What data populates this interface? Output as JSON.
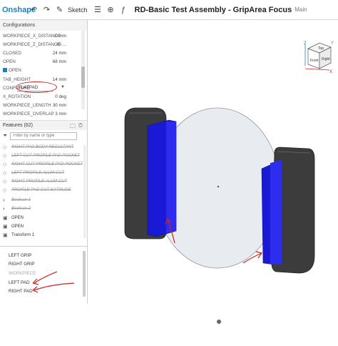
{
  "toolbar": {
    "brand": "Onshape",
    "sketch_label": "Sketch",
    "document_title": "RD-Basic Test Assembly - GripArea Focus",
    "branch": "Main"
  },
  "configurations": {
    "header": "Configurations",
    "rows": [
      {
        "label": "WORKPIECE_X_DISTANCE",
        "value": "0 mm"
      },
      {
        "label": "WORKPIECE_Z_DISTANCE",
        "value": "45 ..."
      },
      {
        "label": "CLOSED",
        "value": "24 mm"
      },
      {
        "label": "OPEN",
        "value": "68 mm"
      },
      {
        "label": "OPEN",
        "value": ""
      },
      {
        "label": "TAB_HEIGHT",
        "value": "14 mm"
      },
      {
        "label": "CONFIGURE",
        "value": "FLATPAD"
      },
      {
        "label": "X_ROTATION",
        "value": "0 deg"
      },
      {
        "label": "WORKPIECE_LENGTH",
        "value": "30 mm"
      },
      {
        "label": "WORKPIECE_OVERLAP",
        "value": "3 mm"
      }
    ]
  },
  "features": {
    "header": "Features (62)",
    "filter_placeholder": "Filter by name or type",
    "items": [
      {
        "label": "RIGHT PAD BODY RESULTANT",
        "suppressed": true
      },
      {
        "label": "LEFT CUT PROFILE PAD POCKET",
        "suppressed": true
      },
      {
        "label": "RIGHT CUT PROFILE PAD POCKET",
        "suppressed": true
      },
      {
        "label": "LEFT PROFILE ALUM CUT",
        "suppressed": true
      },
      {
        "label": "RIGHT PROFILE ALUM CUT",
        "suppressed": true
      },
      {
        "label": "PROFILE PAD CUT EXTRUDE",
        "suppressed": true
      },
      {
        "label": "Boolean 1",
        "suppressed": true
      },
      {
        "label": "Boolean 2",
        "suppressed": true
      },
      {
        "label": "OPEN",
        "suppressed": false
      },
      {
        "label": "OPEN",
        "suppressed": false
      },
      {
        "label": "Transform 1",
        "suppressed": false
      }
    ]
  },
  "parts": {
    "items": [
      {
        "label": "LEFT GRIP",
        "dim": false
      },
      {
        "label": "RIGHT GRIP",
        "dim": false
      },
      {
        "label": "WORKPIECE",
        "dim": true
      },
      {
        "label": "LEFT PAD",
        "dim": false
      },
      {
        "label": "RIGHT PAD",
        "dim": false
      }
    ]
  },
  "navcube": {
    "top": "Top",
    "front": "Front",
    "right": "Right",
    "axis_x": "X",
    "axis_y": "Y",
    "axis_z": "Z"
  },
  "colors": {
    "brand": "#1e7fc4",
    "pad_blue": "#1a1ad6",
    "grip_dark": "#3c3c3c",
    "annotation_red": "#d42020"
  }
}
